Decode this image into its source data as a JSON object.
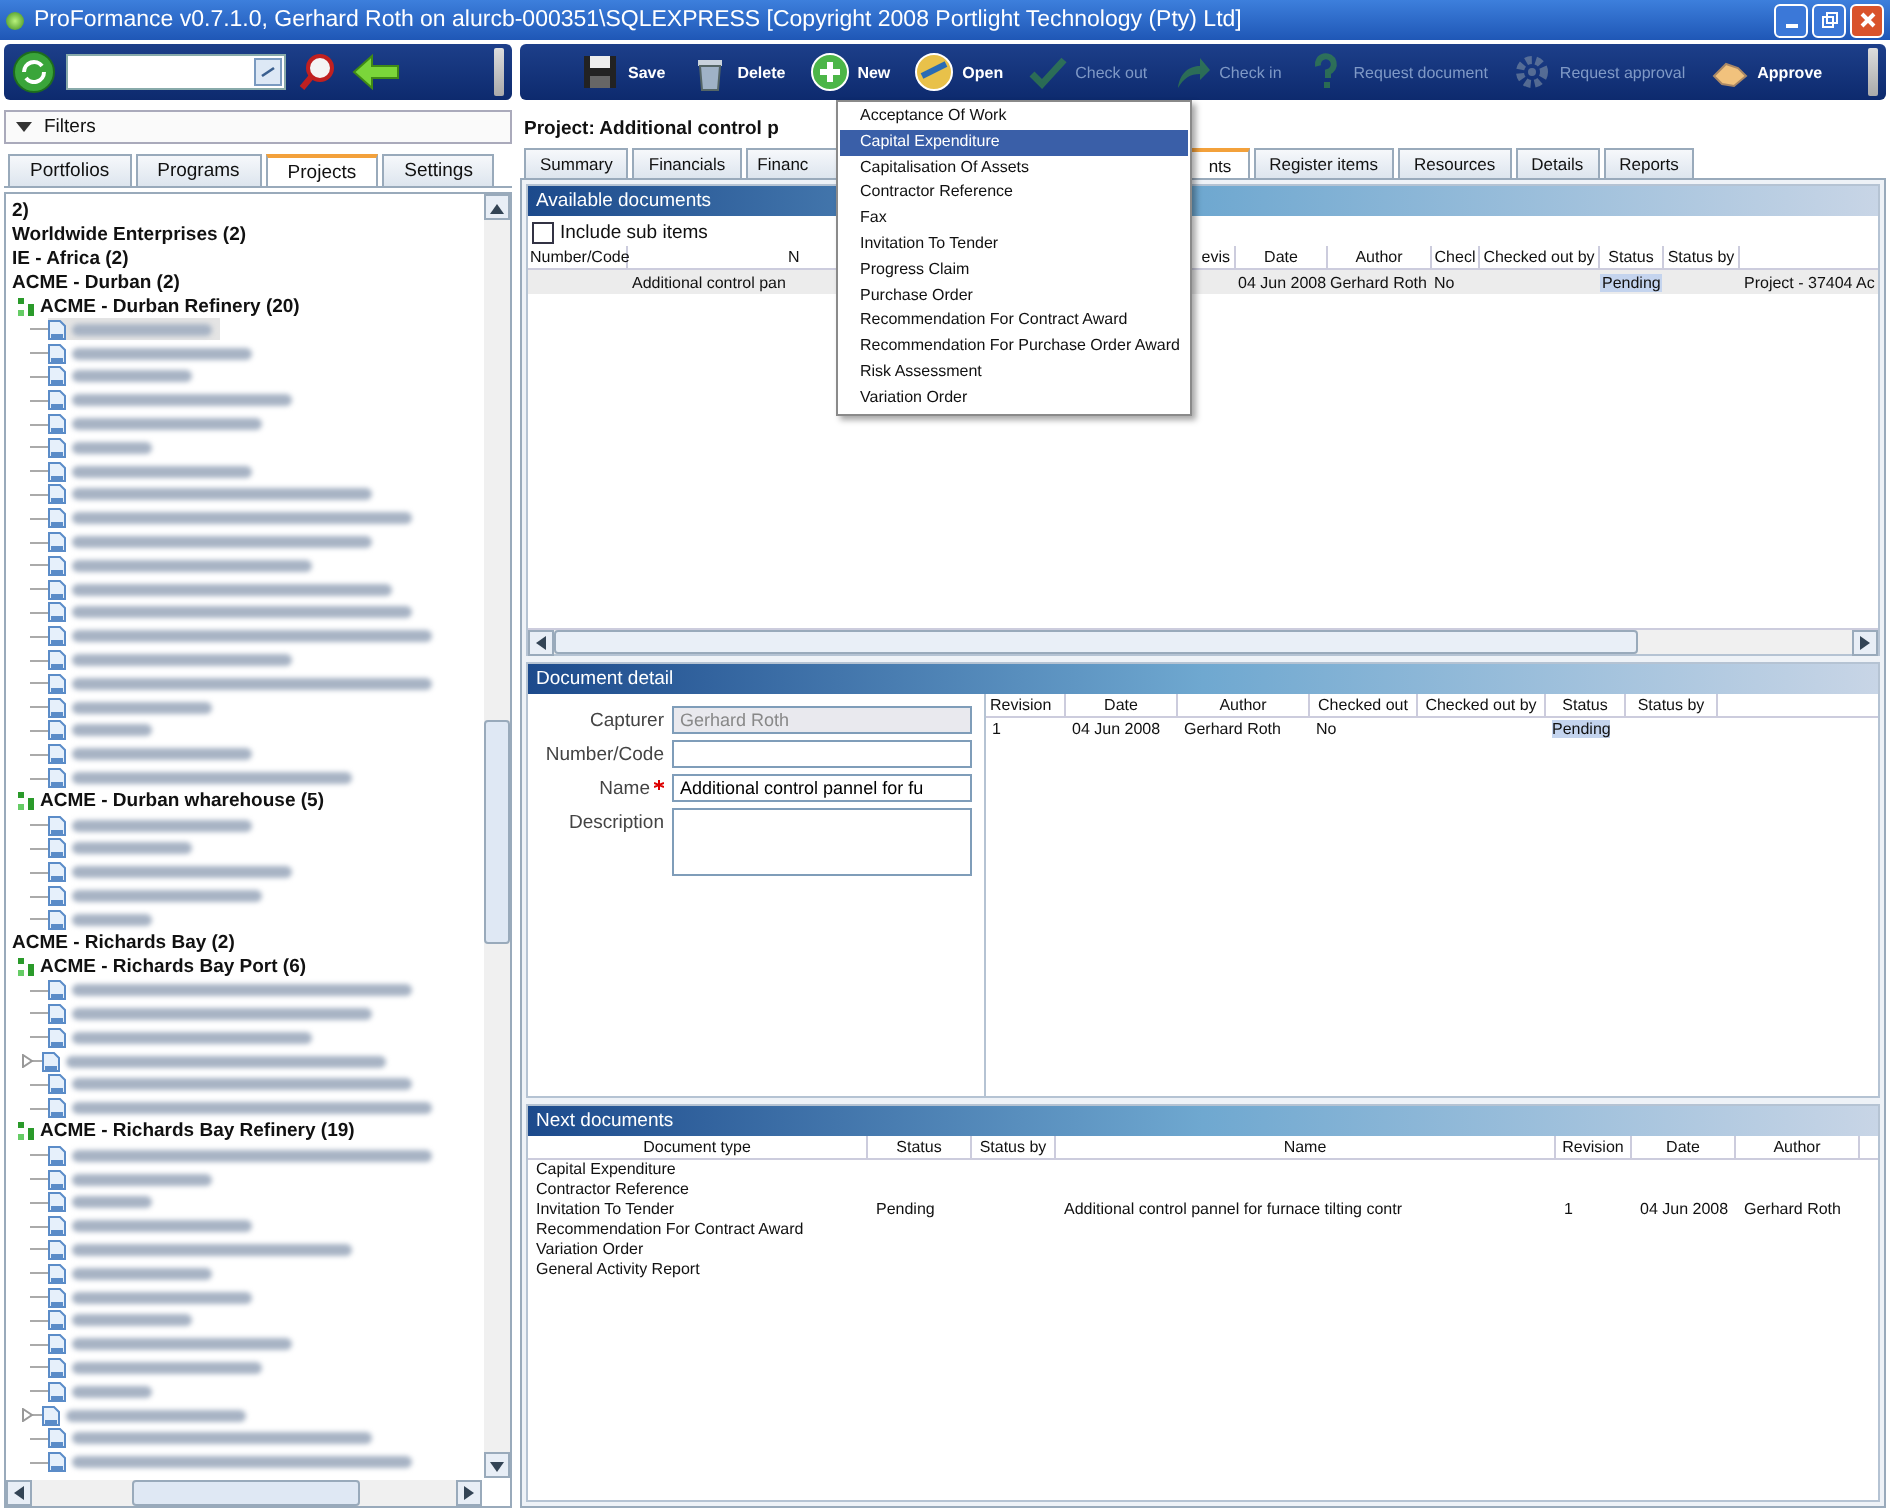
{
  "window": {
    "title": "ProFormance v0.7.1.0, Gerhard Roth on alurcb-000351\\SQLEXPRESS [Copyright 2008 Portlight Technology (Pty) Ltd]"
  },
  "filters": {
    "label": "Filters"
  },
  "left_tabs": [
    {
      "label": "Portfolios",
      "selected": false
    },
    {
      "label": "Programs",
      "selected": false
    },
    {
      "label": "Projects",
      "selected": true
    },
    {
      "label": "Settings",
      "selected": false
    }
  ],
  "tree": [
    {
      "kind": "group",
      "label": "2)",
      "children": [
        {
          "kind": "group",
          "label": "Worldwide Enterprises (2)",
          "children": [
            {
              "kind": "group",
              "label": "IE - Africa (2)",
              "children": [
                {
                  "kind": "group",
                  "label": "ACME - Durban (2)",
                  "children": [
                    {
                      "kind": "site",
                      "label": "ACME - Durban Refinery (20)",
                      "children": [
                        {
                          "kind": "redacted",
                          "selected": true
                        },
                        {
                          "kind": "redacted",
                          "selected": false
                        },
                        {
                          "kind": "redacted",
                          "selected": false
                        },
                        {
                          "kind": "redacted",
                          "selected": false
                        },
                        {
                          "kind": "redacted",
                          "selected": false
                        },
                        {
                          "kind": "redacted",
                          "selected": false
                        },
                        {
                          "kind": "redacted",
                          "selected": false
                        },
                        {
                          "kind": "redacted",
                          "selected": false
                        },
                        {
                          "kind": "redacted",
                          "selected": false
                        },
                        {
                          "kind": "redacted",
                          "selected": false
                        },
                        {
                          "kind": "redacted",
                          "selected": false
                        },
                        {
                          "kind": "redacted",
                          "selected": false
                        },
                        {
                          "kind": "redacted",
                          "selected": false
                        },
                        {
                          "kind": "redacted",
                          "selected": false
                        },
                        {
                          "kind": "redacted",
                          "selected": false
                        },
                        {
                          "kind": "redacted",
                          "selected": false
                        },
                        {
                          "kind": "redacted",
                          "selected": false
                        },
                        {
                          "kind": "redacted",
                          "selected": false
                        },
                        {
                          "kind": "redacted",
                          "selected": false
                        },
                        {
                          "kind": "redacted",
                          "selected": false
                        }
                      ]
                    },
                    {
                      "kind": "site",
                      "label": "ACME - Durban wharehouse (5)",
                      "children": [
                        {
                          "kind": "redacted",
                          "selected": false
                        },
                        {
                          "kind": "redacted",
                          "selected": false
                        },
                        {
                          "kind": "redacted",
                          "selected": false
                        },
                        {
                          "kind": "redacted",
                          "selected": false
                        },
                        {
                          "kind": "redacted",
                          "selected": false
                        }
                      ]
                    }
                  ]
                },
                {
                  "kind": "group",
                  "label": "ACME - Richards Bay (2)",
                  "children": [
                    {
                      "kind": "site",
                      "label": "ACME - Richards Bay Port (6)",
                      "children": [
                        {
                          "kind": "redacted",
                          "selected": false
                        },
                        {
                          "kind": "redacted",
                          "selected": false
                        },
                        {
                          "kind": "redacted",
                          "selected": false
                        },
                        {
                          "kind": "redacted",
                          "selected": false,
                          "has_children": true
                        },
                        {
                          "kind": "redacted",
                          "selected": false
                        },
                        {
                          "kind": "redacted",
                          "selected": false
                        }
                      ]
                    },
                    {
                      "kind": "site",
                      "label": "ACME - Richards Bay Refinery (19)",
                      "children": [
                        {
                          "kind": "redacted",
                          "selected": false
                        },
                        {
                          "kind": "redacted",
                          "selected": false
                        },
                        {
                          "kind": "redacted",
                          "selected": false
                        },
                        {
                          "kind": "redacted",
                          "selected": false
                        },
                        {
                          "kind": "redacted",
                          "selected": false
                        },
                        {
                          "kind": "redacted",
                          "selected": false
                        },
                        {
                          "kind": "redacted",
                          "selected": false
                        },
                        {
                          "kind": "redacted",
                          "selected": false
                        },
                        {
                          "kind": "redacted",
                          "selected": false
                        },
                        {
                          "kind": "redacted",
                          "selected": false
                        },
                        {
                          "kind": "redacted",
                          "selected": false
                        },
                        {
                          "kind": "redacted",
                          "selected": false,
                          "has_children": true
                        },
                        {
                          "kind": "redacted",
                          "selected": false
                        },
                        {
                          "kind": "redacted",
                          "selected": false
                        }
                      ]
                    }
                  ]
                }
              ]
            }
          ]
        }
      ]
    }
  ],
  "toolbar": [
    {
      "label": "Save",
      "disabled": false
    },
    {
      "label": "Delete",
      "disabled": false
    },
    {
      "label": "New",
      "disabled": false
    },
    {
      "label": "Open",
      "disabled": false
    },
    {
      "label": "Check out",
      "disabled": true
    },
    {
      "label": "Check in",
      "disabled": true
    },
    {
      "label": "Request document",
      "disabled": true
    },
    {
      "label": "Request approval",
      "disabled": true
    },
    {
      "label": "Approve",
      "disabled": false
    }
  ],
  "project_heading": "Project: Additional control p",
  "tabs": [
    {
      "label": "Summary",
      "selected": false
    },
    {
      "label": "Financials",
      "selected": false
    },
    {
      "label": "Financ",
      "selected": false
    },
    {
      "label": "nts",
      "selected": true
    },
    {
      "label": "Register items",
      "selected": false
    },
    {
      "label": "Resources",
      "selected": false
    },
    {
      "label": "Details",
      "selected": false
    },
    {
      "label": "Reports",
      "selected": false
    }
  ],
  "new_menu": [
    {
      "label": "Acceptance Of Work",
      "selected": false
    },
    {
      "label": "Capital Expenditure",
      "selected": true
    },
    {
      "label": "Capitalisation Of Assets",
      "selected": false
    },
    {
      "label": "Contractor Reference",
      "selected": false
    },
    {
      "label": "Fax",
      "selected": false
    },
    {
      "label": "Invitation To Tender",
      "selected": false
    },
    {
      "label": "Progress Claim",
      "selected": false
    },
    {
      "label": "Purchase Order",
      "selected": false
    },
    {
      "label": "Recommendation For Contract Award",
      "selected": false
    },
    {
      "label": "Recommendation For Purchase Order Award",
      "selected": false
    },
    {
      "label": "Risk Assessment",
      "selected": false
    },
    {
      "label": "Variation Order",
      "selected": false
    }
  ],
  "available_documents": {
    "title": "Available documents",
    "include_sub_items": {
      "label": "Include sub items",
      "checked": false
    },
    "columns": [
      "Number/Code",
      "N",
      "evis",
      "Date",
      "Author",
      "Checl",
      "Checked out by",
      "Status",
      "Status by"
    ],
    "rows": [
      {
        "selected": true,
        "cells": [
          "",
          "Additional control pan",
          "",
          "04 Jun 2008",
          "Gerhard Roth",
          "No",
          "",
          "Pending",
          "",
          "Project - 37404 Ac"
        ]
      }
    ]
  },
  "document_detail": {
    "title": "Document detail",
    "fields": [
      {
        "label": "Capturer",
        "value": "Gerhard Roth",
        "disabled": true,
        "kind": "text"
      },
      {
        "label": "Number/Code",
        "disabled": false,
        "kind": "text"
      },
      {
        "label": "Name",
        "value": "Additional control pannel for fu",
        "disabled": false,
        "required": true,
        "kind": "text"
      },
      {
        "label": "Description",
        "disabled": false,
        "kind": "area"
      }
    ],
    "columns": [
      "Revision",
      "Date",
      "Author",
      "Checked out",
      "Checked out by",
      "Status",
      "Status by"
    ],
    "rows": [
      {
        "cells": [
          "1",
          "04 Jun 2008",
          "Gerhard Roth",
          "No",
          "",
          "Pending",
          ""
        ]
      }
    ]
  },
  "next_documents": {
    "title": "Next documents",
    "columns": [
      "Document type",
      "Status",
      "Status by",
      "Name",
      "Revision",
      "Date",
      "Author"
    ],
    "rows": [
      {
        "cells": [
          "Capital Expenditure",
          "",
          "",
          "",
          "",
          "",
          ""
        ]
      },
      {
        "cells": [
          "Contractor Reference",
          "",
          "",
          "",
          "",
          "",
          ""
        ]
      },
      {
        "cells": [
          "Invitation To Tender",
          "Pending",
          "",
          "Additional control pannel for furnace tilting contr",
          "1",
          "04 Jun 2008",
          "Gerhard Roth"
        ]
      },
      {
        "cells": [
          "Recommendation For Contract Award",
          "",
          "",
          "",
          "",
          "",
          ""
        ]
      },
      {
        "cells": [
          "Variation Order",
          "",
          "",
          "",
          "",
          "",
          ""
        ]
      },
      {
        "cells": [
          "General Activity Report",
          "",
          "",
          "",
          "",
          "",
          ""
        ]
      }
    ]
  }
}
